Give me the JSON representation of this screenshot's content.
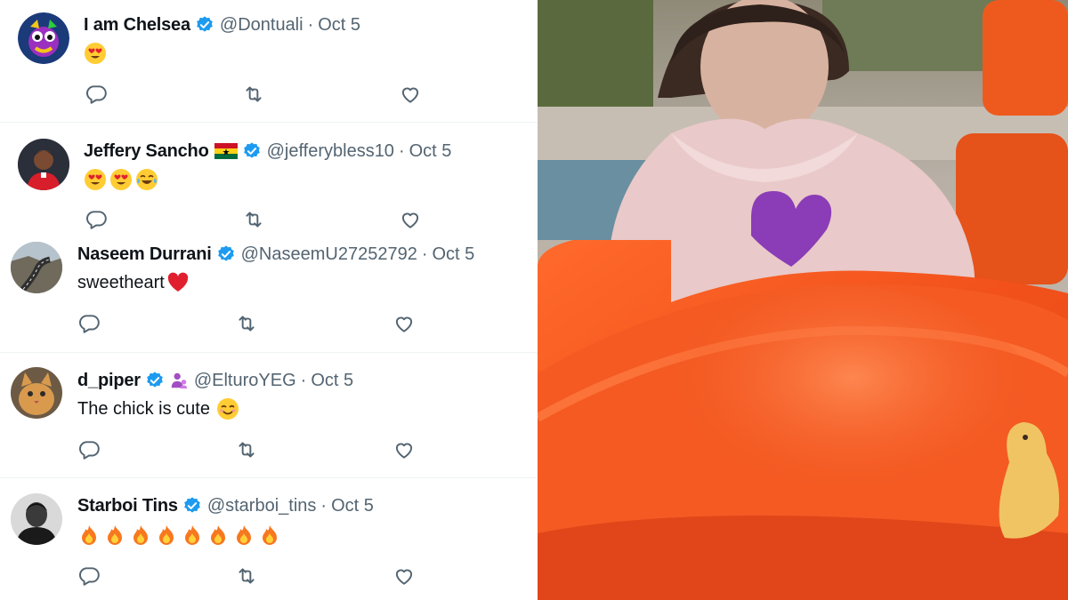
{
  "colors": {
    "verified": "#1d9bf0",
    "secondary_text": "#536471",
    "primary_text": "#0f1419",
    "divider": "#eff3f4",
    "heart_red": "#e0202e",
    "slide_orange": "#f2511b"
  },
  "replies": [
    {
      "name": "I am Chelsea",
      "handle": "@Dontuali",
      "separator": "·",
      "date": "Oct 5",
      "verified": true,
      "text": "",
      "emojis": [
        "heart-eyes-emoji"
      ],
      "avatar": "mascot-avatar",
      "actions": [
        "reply-icon",
        "retweet-icon",
        "like-icon"
      ]
    },
    {
      "name": "Jeffery Sancho",
      "handle": "@jefferybless10",
      "separator": "·",
      "date": "Oct 5",
      "verified": true,
      "flag": "ghana-flag",
      "text": "",
      "emojis": [
        "heart-eyes-emoji",
        "heart-eyes-emoji",
        "tears-of-joy-emoji"
      ],
      "avatar": "footballer-avatar",
      "actions": [
        "reply-icon",
        "retweet-icon",
        "like-icon"
      ]
    },
    {
      "name": "Naseem Durrani",
      "handle": "@NaseemU27252792",
      "separator": "·",
      "date": "Oct 5",
      "verified": true,
      "text": "sweetheart",
      "emojis": [
        "red-heart-emoji"
      ],
      "avatar": "road-landscape-avatar",
      "actions": [
        "reply-icon",
        "retweet-icon",
        "like-icon"
      ]
    },
    {
      "name": "d_piper",
      "handle": "@ElturoYEG",
      "separator": "·",
      "date": "Oct 5",
      "verified": true,
      "extra_badge": "person-bald-emoji",
      "text": "The chick is cute",
      "emojis": [
        "smiling-face-emoji"
      ],
      "avatar": "cat-avatar",
      "actions": [
        "reply-icon",
        "retweet-icon",
        "like-icon"
      ]
    },
    {
      "name": "Starboi Tins",
      "handle": "@starboi_tins",
      "separator": "·",
      "date": "Oct 5",
      "verified": true,
      "text": "",
      "emojis": [
        "fire-emoji",
        "fire-emoji",
        "fire-emoji",
        "fire-emoji",
        "fire-emoji",
        "fire-emoji",
        "fire-emoji",
        "fire-emoji"
      ],
      "avatar": "portrait-avatar",
      "actions": [
        "reply-icon",
        "retweet-icon",
        "like-icon"
      ]
    }
  ],
  "media": {
    "description_icon": "video-still-child-on-slide"
  }
}
